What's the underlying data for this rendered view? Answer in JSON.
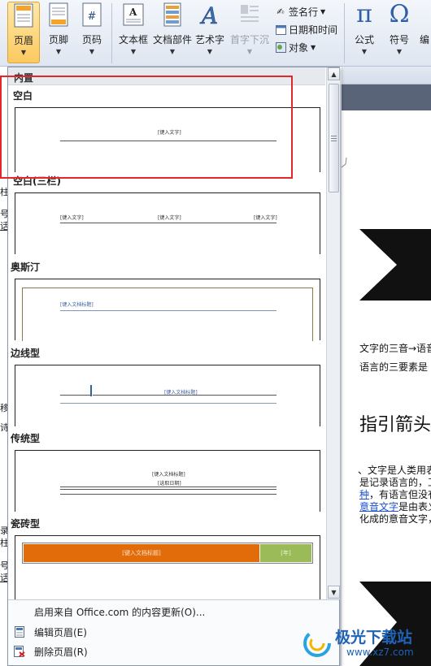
{
  "ribbon": {
    "header": {
      "label": "页眉"
    },
    "footer": {
      "label": "页脚"
    },
    "page_number": {
      "label": "页码"
    },
    "textbox": {
      "label": "文本框"
    },
    "quick_parts": {
      "label": "文档部件"
    },
    "wordart": {
      "label": "艺术字"
    },
    "dropcap": {
      "label": "首字下沉"
    },
    "signature_line": {
      "label": "签名行"
    },
    "date_time": {
      "label": "日期和时间"
    },
    "object": {
      "label": "对象"
    },
    "equation": {
      "label": "公式"
    },
    "symbol": {
      "label": "符号"
    },
    "number_partial": {
      "label": "编"
    },
    "group_symbols": {
      "label": "符号"
    }
  },
  "gallery": {
    "section_builtin": "内置",
    "items": [
      {
        "title": "空白",
        "placeholders": [
          "[键入文字]"
        ]
      },
      {
        "title": "空白(三栏)",
        "placeholders": [
          "[键入文字]",
          "[键入文字]",
          "[键入文字]"
        ]
      },
      {
        "title": "奥斯汀",
        "placeholders": [
          "[键入文档标题]"
        ]
      },
      {
        "title": "边线型",
        "placeholders": [
          "[键入文档标题]"
        ]
      },
      {
        "title": "传统型",
        "placeholders": [
          "[键入文档标题]",
          "[选取日期]"
        ]
      },
      {
        "title": "瓷砖型",
        "placeholders": [
          "[键入文档标题]",
          "[年]"
        ]
      }
    ],
    "tile_colors": {
      "orange": "#e36c0a",
      "green": "#9bbb59"
    }
  },
  "menu": {
    "update_office": "启用来自 Office.com 的内容更新(O)...",
    "edit_header": "编辑页眉(E)",
    "remove_header": "删除页眉(R)"
  },
  "document": {
    "line1": "文字的三音→语音",
    "line2": "语言的三要素是",
    "heading": "指引箭头",
    "p1": "、文字是人类用表",
    "p2a": "是记录语言的，工",
    "p3_link": "种",
    "p3_rest": "，有语言但没有",
    "p4_link": "意音文字",
    "p4_rest": "是由表义",
    "p5": "化成的意音文字，"
  },
  "left_fragments": [
    "柱",
    "号",
    "话",
    "移",
    "诗",
    "录",
    "柱",
    "号",
    "话"
  ],
  "watermark": {
    "title": "极光下载站",
    "url": "www.xz7.com"
  }
}
